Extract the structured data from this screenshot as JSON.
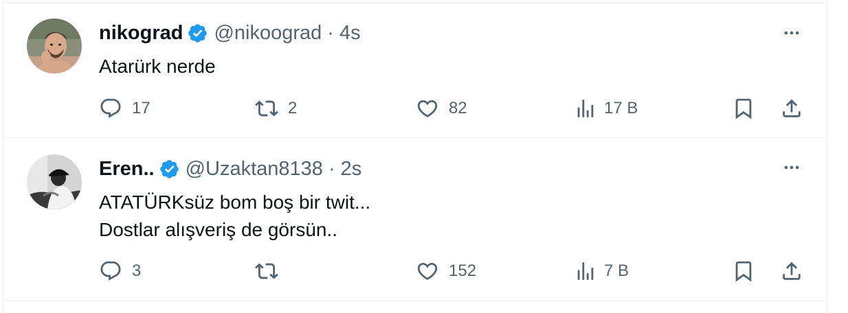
{
  "colors": {
    "text": "#0f1419",
    "secondary": "#536471",
    "verified": "#1d9bf0",
    "divider": "#eff3f4"
  },
  "tweets": [
    {
      "name": "nikograd",
      "handle": "@nikoograd",
      "separator": "·",
      "time": "4s",
      "verified_icon": "verified-badge-icon",
      "lines": [
        "Atarürk nerde"
      ],
      "replies": "17",
      "retweets": "2",
      "likes": "82",
      "views": "17 B"
    },
    {
      "name": "Eren..",
      "handle": "@Uzaktan8138",
      "separator": "·",
      "time": "2s",
      "verified_icon": "verified-badge-icon",
      "lines": [
        "ATATÜRKsüz bom boş bir twit...",
        "Dostlar alışveriş de görsün.."
      ],
      "replies": "3",
      "retweets": "",
      "likes": "152",
      "views": "7 B"
    }
  ]
}
